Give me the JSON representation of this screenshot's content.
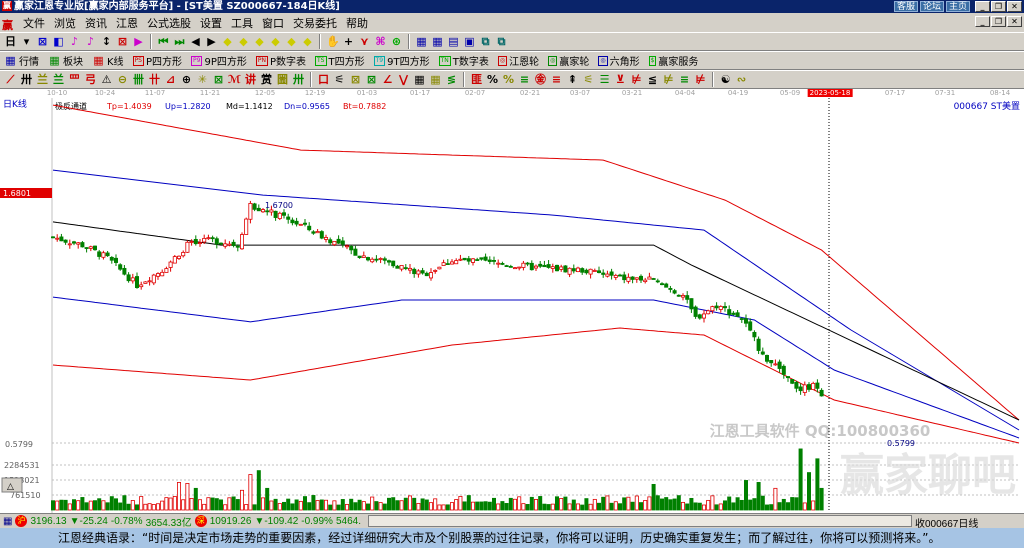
{
  "window": {
    "title": "赢家江恩专业版[赢家内部服务平台] - [ST美置   SZ000667-184日K线]",
    "links": [
      "客服",
      "论坛",
      "主页"
    ]
  },
  "menu": [
    "文件",
    "浏览",
    "资讯",
    "江恩",
    "公式选股",
    "设置",
    "工具",
    "窗口",
    "交易委托",
    "帮助"
  ],
  "toolbar2": [
    {
      "badge": "",
      "label": "行情"
    },
    {
      "badge": "",
      "label": "板块"
    },
    {
      "badge": "",
      "label": "K线"
    },
    {
      "badge": "PS",
      "label": "P四方形"
    },
    {
      "badge": "P9",
      "label": "9P四方形"
    },
    {
      "badge": "PN",
      "label": "P数字表"
    },
    {
      "badge": "TS",
      "label": "T四方形"
    },
    {
      "badge": "T9",
      "label": "9T四方形"
    },
    {
      "badge": "TN",
      "label": "T数字表"
    },
    {
      "badge": "◎",
      "label": "江恩轮"
    },
    {
      "badge": "◎",
      "label": "赢家轮"
    },
    {
      "badge": "◎",
      "label": "六角形"
    },
    {
      "badge": "$",
      "label": "赢家服务"
    }
  ],
  "toolbar1": {
    "period": "日"
  },
  "chart": {
    "period_label": "日K线",
    "indicator": {
      "name": "极反通道",
      "tp": "Tp=1.4039",
      "up": "Up=1.2820",
      "md": "Md=1.1412",
      "dn": "Dn=0.9565",
      "bt": "Bt=0.7882"
    },
    "stock": "000667  ST美置",
    "dates": [
      "10-10",
      "10-24",
      "11-07",
      "11-21",
      "12-05",
      "12-19",
      "01-03",
      "01-17",
      "02-07",
      "02-21",
      "03-07",
      "03-21",
      "04-04",
      "04-19",
      "05-09",
      "2023-05-18",
      "07-17",
      "07-31",
      "08-14"
    ],
    "cursor_date": "2023-05-18",
    "price_high_label": "1.6801",
    "high_point": "1.6700",
    "low_label": "0.5799",
    "low_point": "0.5799",
    "volume_ticks": [
      "2284531",
      "1523021",
      "761510"
    ],
    "watermark": "江恩工具软件  QQ:100800360",
    "watermark2": "赢家聊吧"
  },
  "chart_data": {
    "type": "candlestick",
    "price_range": [
      0.5799,
      1.6801
    ],
    "close_keypoints": [
      [
        0,
        1.486
      ],
      [
        7,
        1.451
      ],
      [
        13,
        1.394
      ],
      [
        20,
        1.275
      ],
      [
        26,
        1.341
      ],
      [
        32,
        1.451
      ],
      [
        38,
        1.473
      ],
      [
        44,
        1.451
      ],
      [
        47,
        1.627
      ],
      [
        52,
        1.592
      ],
      [
        59,
        1.539
      ],
      [
        66,
        1.473
      ],
      [
        73,
        1.407
      ],
      [
        80,
        1.376
      ],
      [
        88,
        1.319
      ],
      [
        95,
        1.385
      ],
      [
        102,
        1.376
      ],
      [
        109,
        1.363
      ],
      [
        116,
        1.35
      ],
      [
        126,
        1.341
      ],
      [
        135,
        1.306
      ],
      [
        142,
        1.297
      ],
      [
        150,
        1.231
      ],
      [
        153,
        1.13
      ],
      [
        158,
        1.187
      ],
      [
        164,
        1.13
      ],
      [
        169,
        0.967
      ],
      [
        172,
        0.923
      ],
      [
        177,
        0.813
      ],
      [
        182,
        0.835
      ],
      [
        183,
        0.778
      ]
    ],
    "bands": {
      "Tp": [
        [
          0,
          2.067
        ],
        [
          59,
          1.869
        ],
        [
          131,
          1.825
        ],
        [
          160,
          1.649
        ],
        [
          183,
          1.429
        ],
        [
          230,
          0.681
        ]
      ],
      "Up": [
        [
          0,
          1.781
        ],
        [
          50,
          1.671
        ],
        [
          119,
          1.583
        ],
        [
          155,
          1.517
        ],
        [
          190,
          1.077
        ],
        [
          230,
          0.637
        ]
      ],
      "Md": [
        [
          0,
          1.553
        ],
        [
          40,
          1.451
        ],
        [
          143,
          1.451
        ],
        [
          152,
          1.363
        ],
        [
          230,
          0.681
        ]
      ],
      "Dn": [
        [
          0,
          1.222
        ],
        [
          47,
          1.113
        ],
        [
          83,
          1.209
        ],
        [
          143,
          1.209
        ],
        [
          167,
          1.121
        ],
        [
          186,
          0.901
        ],
        [
          230,
          0.602
        ]
      ],
      "Bt": [
        [
          0,
          0.923
        ],
        [
          47,
          0.857
        ],
        [
          95,
          1.011
        ],
        [
          135,
          1.086
        ],
        [
          155,
          1.055
        ],
        [
          186,
          0.769
        ],
        [
          230,
          0.58
        ]
      ]
    },
    "volume_max": 3100000,
    "volume_spikes": [
      [
        30,
        1400000
      ],
      [
        32,
        1350000
      ],
      [
        34,
        1100000
      ],
      [
        45,
        1000000
      ],
      [
        47,
        1800000
      ],
      [
        49,
        2000000
      ],
      [
        51,
        1100000
      ],
      [
        143,
        1300000
      ],
      [
        165,
        1500000
      ],
      [
        168,
        1400000
      ],
      [
        172,
        1100000
      ],
      [
        178,
        3100000
      ],
      [
        180,
        1900000
      ],
      [
        182,
        2600000
      ],
      [
        183,
        1100000
      ]
    ],
    "colors": {
      "up": "#e00000",
      "down": "#008000",
      "Tp": "#e00000",
      "Up": "#0000c0",
      "Md": "#000000",
      "Dn": "#0000c0",
      "Bt": "#e00000"
    }
  },
  "status": {
    "sh_index": "3196.13",
    "sh_change": "▼-25.24",
    "sh_pct": "-0.78%",
    "sh_amount": "3654.33亿",
    "sz_index": "10919.26",
    "sz_change": "▼-109.42",
    "sz_pct": "-0.99%",
    "sz_amount": "5464.",
    "right": "收000667日线",
    "sh_icon": "沪",
    "sz_icon": "深"
  },
  "quote": "江恩经典语录：“时间是决定市场走势的重要因素，经过详细研究大市及个别股票的过往记录，你将可以证明，历史确实重复发生；而了解过往，你将可以预测将来。”。"
}
